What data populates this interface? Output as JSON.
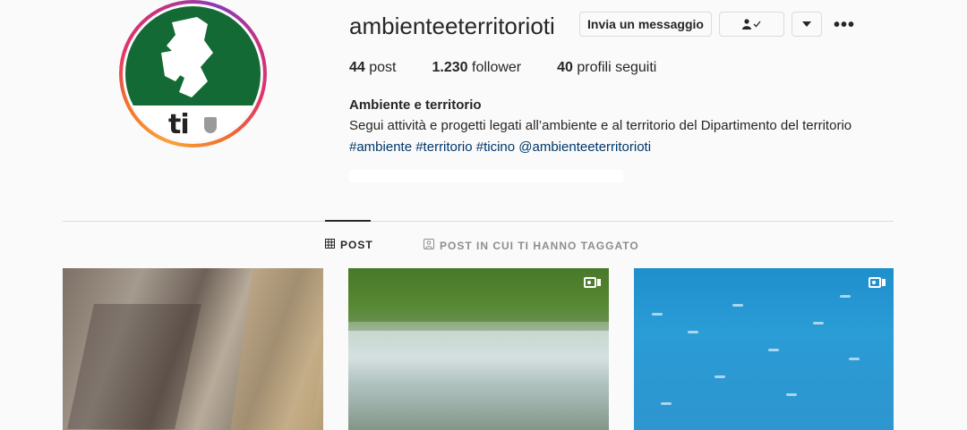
{
  "profile": {
    "username": "ambienteeterritorioti",
    "avatar_text": "ti",
    "buttons": {
      "message": "Invia un messaggio",
      "following_icon": "person-check-icon",
      "dropdown_icon": "caret-down-icon",
      "more": "•••"
    },
    "stats": [
      {
        "value": "44",
        "label": "post"
      },
      {
        "value": "1.230",
        "label": "follower"
      },
      {
        "value": "40",
        "label": "profili seguiti"
      }
    ],
    "bio": {
      "name": "Ambiente e territorio",
      "text": "Segui attività e progetti legati all’ambiente e al territorio del Dipartimento del territorio",
      "tags": "#ambiente #territorio #ticino @ambienteeterritorioti"
    }
  },
  "tabs": [
    {
      "label": "POST",
      "icon": "grid-icon",
      "active": true
    },
    {
      "label": "POST IN CUI TI HANNO TAGGATO",
      "icon": "tagged-icon",
      "active": false
    }
  ],
  "posts": [
    {
      "subject": "rock-cliff-gorge",
      "is_video": false
    },
    {
      "subject": "river-rapids-forest",
      "is_video": true
    },
    {
      "subject": "underwater-fish-school",
      "is_video": true
    }
  ],
  "colors": {
    "link": "#00376b",
    "avatar_green": "#146a35",
    "border": "#dbdbdb"
  }
}
